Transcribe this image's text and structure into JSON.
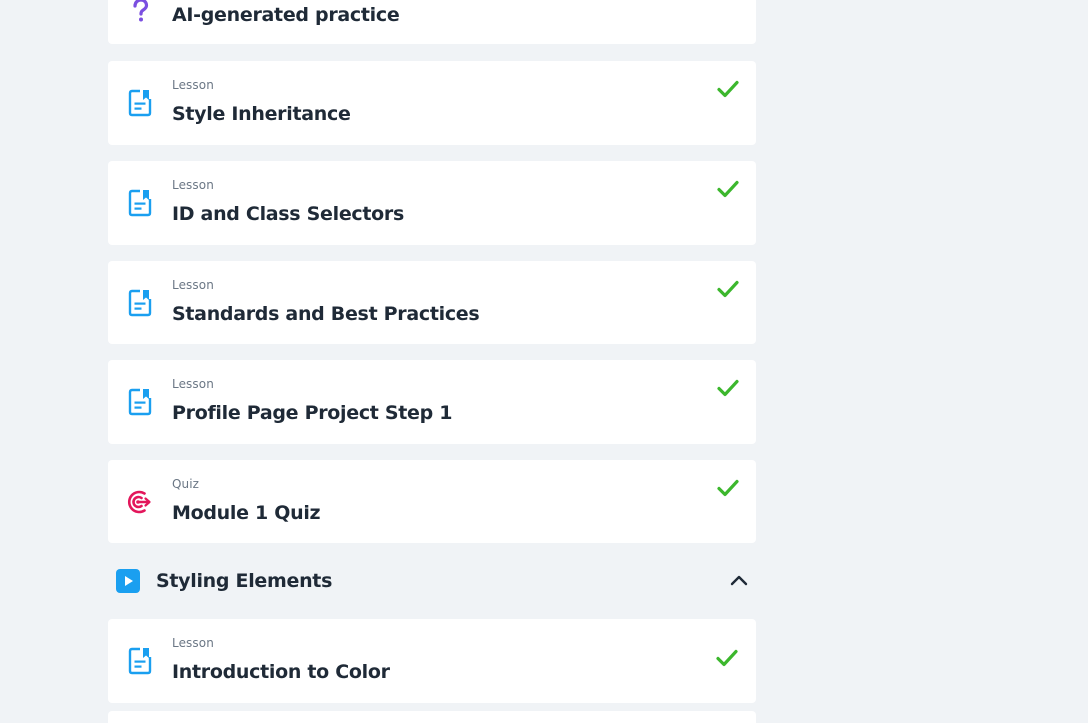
{
  "top_card": {
    "title": "AI-generated practice",
    "icon": "question-mark-icon",
    "icon_color": "#7b4fe0"
  },
  "module1_items": [
    {
      "type": "Lesson",
      "title": "Style Inheritance",
      "icon": "lesson-doc-icon",
      "completed": true
    },
    {
      "type": "Lesson",
      "title": "ID and Class Selectors",
      "icon": "lesson-doc-icon",
      "completed": true
    },
    {
      "type": "Lesson",
      "title": "Standards and Best Practices",
      "icon": "lesson-doc-icon",
      "completed": true
    },
    {
      "type": "Lesson",
      "title": "Profile Page Project Step 1",
      "icon": "lesson-doc-icon",
      "completed": true
    },
    {
      "type": "Quiz",
      "title": "Module 1 Quiz",
      "icon": "quiz-target-icon",
      "completed": true
    }
  ],
  "section": {
    "title": "Styling Elements",
    "icon": "play-icon",
    "expanded": true
  },
  "section_items": [
    {
      "type": "Lesson",
      "title": "Introduction to Color",
      "icon": "lesson-doc-icon",
      "completed": true
    }
  ],
  "colors": {
    "background": "#f0f3f6",
    "card": "#ffffff",
    "lesson_icon": "#1a9ff0",
    "quiz_icon": "#e3165b",
    "check": "#3cb72d",
    "title_text": "#1f2a37",
    "type_text": "#6b7785"
  }
}
